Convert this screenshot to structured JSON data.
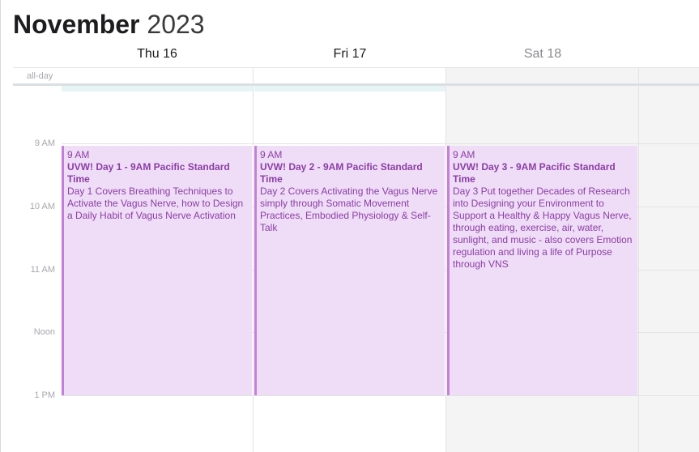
{
  "header": {
    "month": "November",
    "year": "2023"
  },
  "days": [
    {
      "label": "Thu 16"
    },
    {
      "label": "Fri 17"
    },
    {
      "label": "Sat 18"
    }
  ],
  "allday_label": "all-day",
  "time_labels": [
    "9 AM",
    "10 AM",
    "11 AM",
    "Noon",
    "1 PM"
  ],
  "events": [
    {
      "time": "9 AM",
      "title": "UVW! Day 1 - 9AM Pacific Standard Time",
      "description": "Day 1 Covers Breathing Techniques to Activate the Vagus Nerve, how to Design a Daily Habit of Vagus Nerve Activation"
    },
    {
      "time": "9 AM",
      "title": "UVW! Day 2 - 9AM Pacific Standard Time",
      "description": "Day 2 Covers Activating the Vagus Nerve simply through Somatic Movement Practices, Embodied Physiology & Self-Talk"
    },
    {
      "time": "9 AM",
      "title": "UVW! Day 3 - 9AM Pacific Standard Time",
      "description": "Day 3 Put together Decades of Research into Designing your Environment to Support a Healthy & Happy Vagus Nerve, through eating, exercise, air, water, sunlight, and music - also covers Emotion regulation and living a life of Purpose through VNS"
    }
  ],
  "colors": {
    "event_bg": "#efdcf6",
    "event_accent": "#c57ed9",
    "event_text": "#8b3ea5",
    "weekend_bg": "#f4f4f4"
  }
}
